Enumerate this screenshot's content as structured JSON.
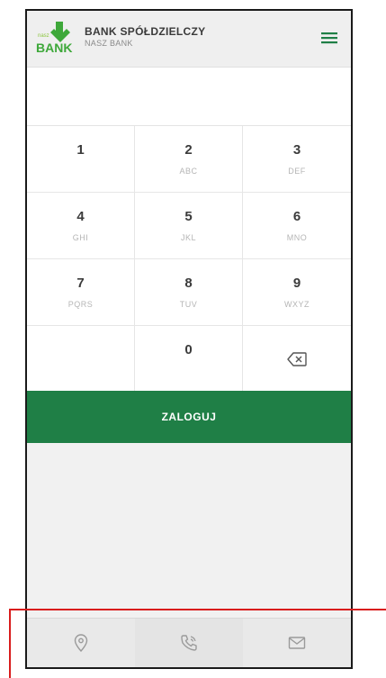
{
  "header": {
    "title": "BANK SPÓŁDZIELCZY",
    "subtitle": "NASZ BANK",
    "logo_top": "nasz",
    "logo_text": "BANK"
  },
  "keypad": {
    "keys": [
      {
        "digit": "1",
        "letters": ""
      },
      {
        "digit": "2",
        "letters": "ABC"
      },
      {
        "digit": "3",
        "letters": "DEF"
      },
      {
        "digit": "4",
        "letters": "GHI"
      },
      {
        "digit": "5",
        "letters": "JKL"
      },
      {
        "digit": "6",
        "letters": "MNO"
      },
      {
        "digit": "7",
        "letters": "PQRS"
      },
      {
        "digit": "8",
        "letters": "TUV"
      },
      {
        "digit": "9",
        "letters": "WXYZ"
      },
      {
        "digit": "",
        "letters": ""
      },
      {
        "digit": "0",
        "letters": ""
      }
    ]
  },
  "login": {
    "label": "ZALOGUJ"
  },
  "footer": {
    "icons": [
      "location-icon",
      "phone-icon",
      "mail-icon"
    ]
  },
  "colors": {
    "brand_green": "#1f7f46",
    "logo_green": "#3ea83a",
    "highlight_red": "#d91c1c"
  }
}
